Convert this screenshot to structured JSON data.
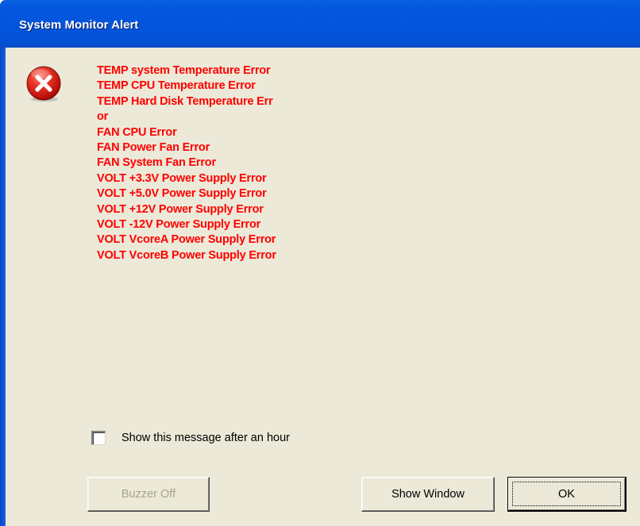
{
  "window": {
    "title": "System Monitor Alert",
    "accent_color": "#0355dc",
    "client_color": "#ece9d8"
  },
  "icon": {
    "name": "error-icon",
    "color": "#e3261c"
  },
  "messages": {
    "color": "#ff0000",
    "items": [
      "TEMP system Temperature Error",
      "TEMP CPU Temperature Error",
      "TEMP Hard Disk Temperature Err",
      "or",
      "FAN CPU Error",
      "FAN Power Fan Error",
      "FAN System Fan Error",
      "VOLT +3.3V Power Supply Error",
      "VOLT +5.0V Power Supply Error",
      "VOLT +12V Power Supply Error",
      "VOLT -12V Power Supply Error",
      "VOLT VcoreA Power Supply Error",
      "VOLT VcoreB Power Supply Error"
    ]
  },
  "checkbox": {
    "label": "Show this message after an hour",
    "checked": false
  },
  "buttons": {
    "buzzer_off": "Buzzer Off",
    "buzzer_off_enabled": false,
    "show_window": "Show Window",
    "ok": "OK"
  }
}
